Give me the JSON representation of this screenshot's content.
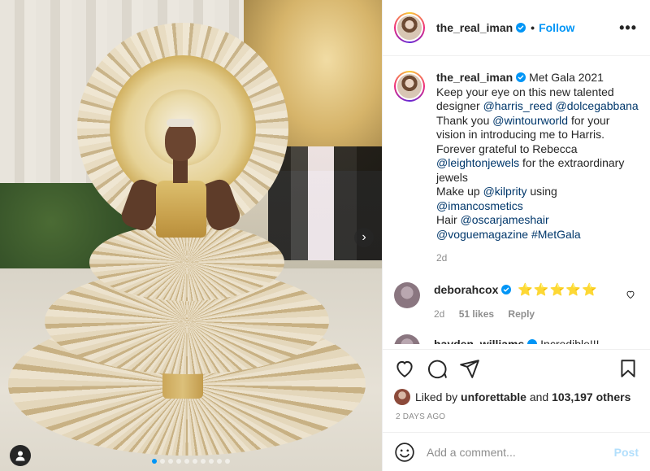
{
  "post": {
    "author": "the_real_iman",
    "follow_label": "Follow",
    "more_label": "•••",
    "separator": "•",
    "photo": {
      "next_arrow": "›",
      "carousel_dots": 10,
      "active_dot": 0
    }
  },
  "caption": {
    "username": "the_real_iman",
    "segments": [
      {
        "type": "text",
        "value": "Met Gala 2021"
      },
      {
        "type": "br"
      },
      {
        "type": "text",
        "value": "Keep your eye on this new talented designer "
      },
      {
        "type": "mention",
        "value": "@harris_reed"
      },
      {
        "type": "text",
        "value": " "
      },
      {
        "type": "mention",
        "value": "@dolcegabbana"
      },
      {
        "type": "br"
      },
      {
        "type": "text",
        "value": "Thank you "
      },
      {
        "type": "mention",
        "value": "@wintourworld"
      },
      {
        "type": "text",
        "value": " for your vision in introducing me to Harris. Forever grateful to Rebecca "
      },
      {
        "type": "mention",
        "value": "@leightonjewels"
      },
      {
        "type": "text",
        "value": " for the extraordinary jewels"
      },
      {
        "type": "br"
      },
      {
        "type": "text",
        "value": "Make up "
      },
      {
        "type": "mention",
        "value": "@kilprity"
      },
      {
        "type": "text",
        "value": " using "
      },
      {
        "type": "mention",
        "value": "@imancosmetics"
      },
      {
        "type": "br"
      },
      {
        "type": "text",
        "value": "Hair "
      },
      {
        "type": "mention",
        "value": "@oscarjameshair"
      },
      {
        "type": "br"
      },
      {
        "type": "mention",
        "value": "@voguemagazine"
      },
      {
        "type": "text",
        "value": " "
      },
      {
        "type": "mention",
        "value": "#MetGala"
      }
    ],
    "age": "2d"
  },
  "comments": [
    {
      "username": "deborahcox",
      "text": "⭐⭐⭐⭐⭐",
      "age": "2d",
      "likes": "51 likes",
      "reply_label": "Reply"
    },
    {
      "username": "hayden_williams",
      "text": "Incredible!!!"
    }
  ],
  "likes": {
    "prefix": "Liked by",
    "first_user": "unforettable",
    "conjunction": "and",
    "others": "103,197 others"
  },
  "timestamp": "2 DAYS AGO",
  "add_comment": {
    "placeholder": "Add a comment...",
    "post_label": "Post"
  },
  "colors": {
    "accent": "#0095f6",
    "mention": "#00376b",
    "muted": "#8e8e8e",
    "post_disabled": "#b2dffc"
  }
}
